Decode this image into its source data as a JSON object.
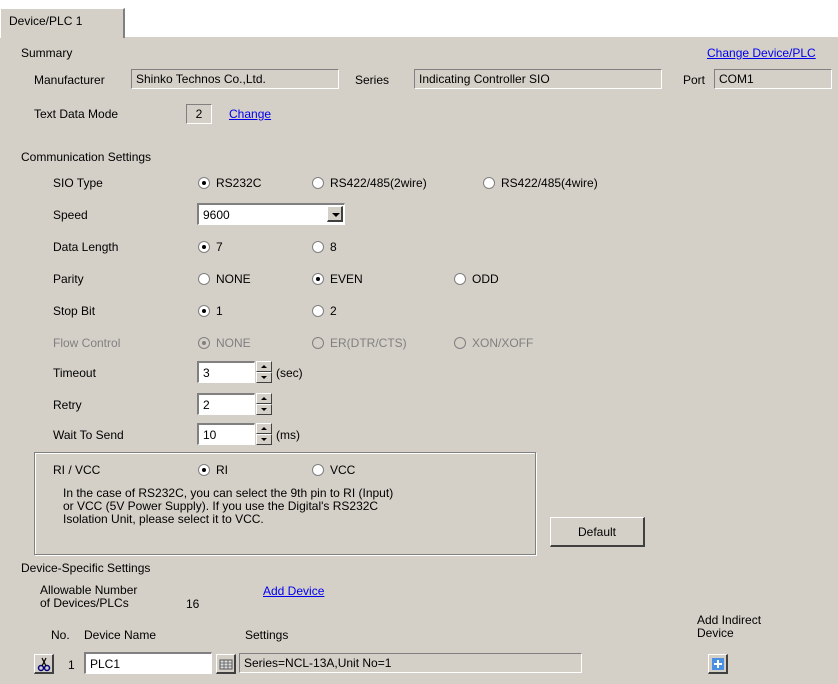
{
  "tab": {
    "label": "Device/PLC 1"
  },
  "summary": {
    "title": "Summary",
    "change_device_link": "Change Device/PLC",
    "manufacturer_label": "Manufacturer",
    "manufacturer_value": "Shinko Technos Co.,Ltd.",
    "series_label": "Series",
    "series_value": "Indicating Controller SIO",
    "port_label": "Port",
    "port_value": "COM1",
    "text_mode_label": "Text Data Mode",
    "text_mode_value": "2",
    "text_mode_change": "Change"
  },
  "comm": {
    "title": "Communication Settings",
    "sio_type": {
      "label": "SIO Type",
      "options": [
        "RS232C",
        "RS422/485(2wire)",
        "RS422/485(4wire)"
      ],
      "selected": "RS232C"
    },
    "speed": {
      "label": "Speed",
      "value": "9600"
    },
    "data_length": {
      "label": "Data Length",
      "options": [
        "7",
        "8"
      ],
      "selected": "7"
    },
    "parity": {
      "label": "Parity",
      "options": [
        "NONE",
        "EVEN",
        "ODD"
      ],
      "selected": "EVEN"
    },
    "stop_bit": {
      "label": "Stop Bit",
      "options": [
        "1",
        "2"
      ],
      "selected": "1"
    },
    "flow_control": {
      "label": "Flow Control",
      "options": [
        "NONE",
        "ER(DTR/CTS)",
        "XON/XOFF"
      ],
      "selected": "NONE"
    },
    "timeout": {
      "label": "Timeout",
      "value": "3",
      "unit": "(sec)"
    },
    "retry": {
      "label": "Retry",
      "value": "2"
    },
    "wait_to_send": {
      "label": "Wait To Send",
      "value": "10",
      "unit": "(ms)"
    },
    "ri_vcc": {
      "label": "RI / VCC",
      "options": [
        "RI",
        "VCC"
      ],
      "selected": "RI",
      "note_line1": "In the case of RS232C, you can select the 9th pin to RI (Input)",
      "note_line2": "or VCC (5V Power Supply). If you use the Digital's RS232C",
      "note_line3": "Isolation Unit, please select it to VCC."
    },
    "default_button": "Default"
  },
  "device": {
    "title": "Device-Specific Settings",
    "allowable_line1": "Allowable Number",
    "allowable_line2": "of Devices/PLCs",
    "allowable_value": "16",
    "add_device_link": "Add Device",
    "col_no": "No.",
    "col_name": "Device Name",
    "col_settings": "Settings",
    "add_indirect_line1": "Add Indirect",
    "add_indirect_line2": "Device",
    "row": {
      "no": "1",
      "name": "PLC1",
      "settings": "Series=NCL-13A,Unit No=1"
    }
  },
  "colors": {
    "panel": "#d4d0c8",
    "link": "#0000ee"
  }
}
